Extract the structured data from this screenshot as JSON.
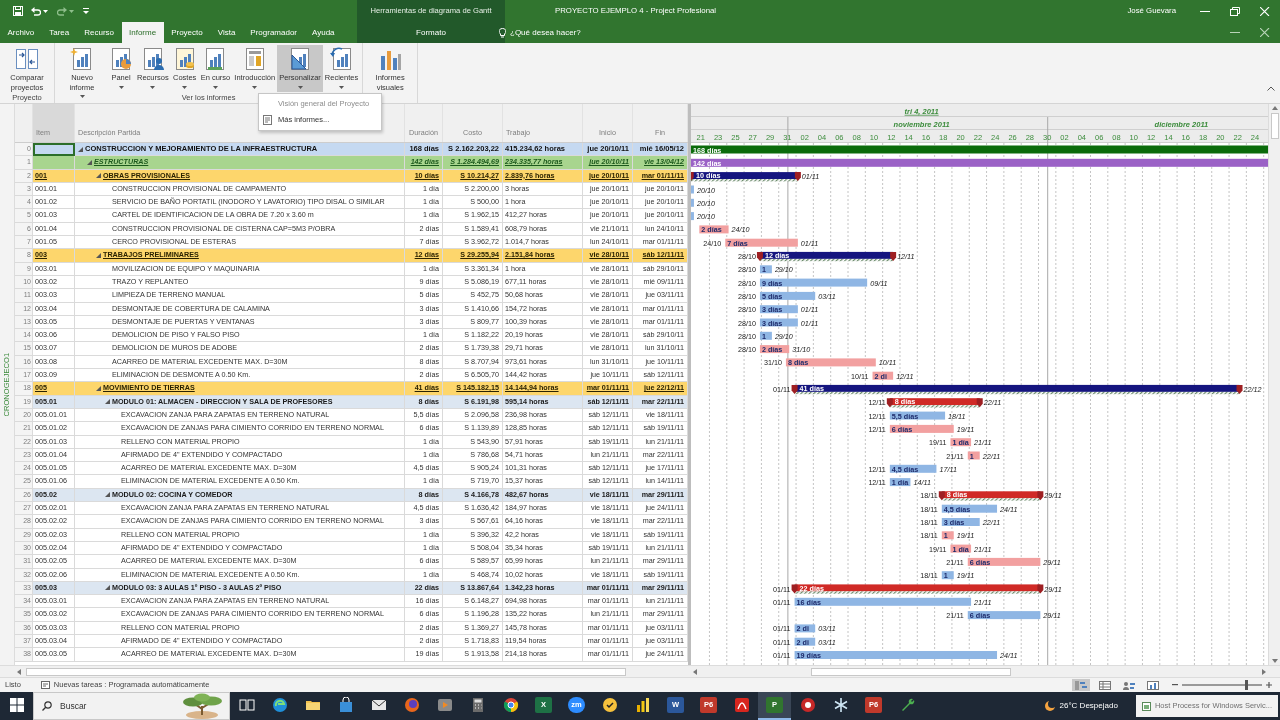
{
  "title_bar": {
    "context_group": "Herramientas de diagrama de Gantt",
    "title": "PROYECTO EJEMPLO 4  -  Project Profesional",
    "user": "José Guevara"
  },
  "tabs": [
    {
      "label": "Archivo",
      "selected": false
    },
    {
      "label": "Tarea",
      "selected": false
    },
    {
      "label": "Recurso",
      "selected": false
    },
    {
      "label": "Informe",
      "selected": true
    },
    {
      "label": "Proyecto",
      "selected": false
    },
    {
      "label": "Vista",
      "selected": false
    },
    {
      "label": "Programador",
      "selected": false
    },
    {
      "label": "Ayuda",
      "selected": false
    }
  ],
  "context_tabs": [
    {
      "label": "Formato",
      "selected": false
    }
  ],
  "tell_me": {
    "placeholder": "¿Qué desea hacer?"
  },
  "ribbon": {
    "groups": [
      {
        "label": "Proyecto",
        "buttons": [
          {
            "label": "Comparar proyectos",
            "dropdown": false,
            "pressed": false
          }
        ]
      },
      {
        "label": "Ver los informes",
        "buttons": [
          {
            "label": "Nuevo informe",
            "dropdown": true,
            "pressed": false
          },
          {
            "label": "Panel",
            "dropdown": true,
            "pressed": false
          },
          {
            "label": "Recursos",
            "dropdown": true,
            "pressed": false
          },
          {
            "label": "Costes",
            "dropdown": true,
            "pressed": false
          },
          {
            "label": "En curso",
            "dropdown": true,
            "pressed": false
          },
          {
            "label": "Introducción",
            "dropdown": true,
            "pressed": false
          },
          {
            "label": "Personalizar",
            "dropdown": true,
            "pressed": true
          },
          {
            "label": "Recientes",
            "dropdown": true,
            "pressed": false
          }
        ]
      },
      {
        "buttons": [
          {
            "label": "Informes visuales",
            "dropdown": false,
            "pressed": false
          }
        ]
      }
    ]
  },
  "menu": {
    "items": [
      {
        "label": "Visión general del Proyecto",
        "disabled": true
      },
      {
        "label": "Más informes...",
        "disabled": false
      }
    ]
  },
  "view_bar": {
    "label": "CRONOGEJECO1"
  },
  "table": {
    "columns": [
      {
        "label": "Item",
        "selected": true
      },
      {
        "label": "Descripción Partida",
        "selected": false
      },
      {
        "label": "Duración",
        "selected": false
      },
      {
        "label": "Costo",
        "selected": false
      },
      {
        "label": "Trabajo",
        "selected": false
      },
      {
        "label": "Inicio",
        "selected": false
      },
      {
        "label": "Fin",
        "selected": false
      }
    ],
    "rows": [
      {
        "id": "0",
        "description": "CONSTRUCCION Y MEJORAMIENTO DE LA INFRAESTRUCTURA",
        "duration": "168 días",
        "cost": "S 2.162.203,22",
        "work": "415.234,62 horas",
        "start": "jue 20/10/11",
        "finish": "mié 16/05/12",
        "selected": true,
        "expanded": true,
        "gantt_bar": {
          "kind": "project",
          "duration": "168 días"
        },
        "children": [
          {
            "id": "1",
            "description": "ESTRUCTURAS",
            "duration": "142 días",
            "cost": "S 1.284.494,69",
            "work": "234.335,77 horas",
            "start": "jue 20/10/11",
            "finish": "vie 13/04/12",
            "selected": false,
            "expanded": true,
            "gantt_bar": {
              "kind": "phase",
              "duration": "142 días"
            },
            "children": [
              {
                "id": "2",
                "item": "001",
                "description": "OBRAS PROVISIONALES",
                "duration": "10 días",
                "cost": "S 10.214,27",
                "work": "2.839,76 horas",
                "start": "jue 20/10/11",
                "finish": "mar 01/11/11",
                "selected": false,
                "expanded": true,
                "gantt_bar": {
                  "kind": "summary",
                  "critical": false,
                  "duration": "10 días",
                  "end": "01/11"
                },
                "children": [
                  {
                    "id": "3",
                    "item": "001.01",
                    "description": "CONSTRUCCION PROVISIONAL DE CAMPAMENTO",
                    "duration": "1 día",
                    "cost": "S 2.200,00",
                    "work": "3 horas",
                    "start": "jue 20/10/11",
                    "finish": "jue 20/10/11",
                    "selected": false,
                    "gantt_bar": {
                      "kind": "task",
                      "critical": false,
                      "end": "20/10"
                    }
                  },
                  {
                    "id": "4",
                    "item": "001.02",
                    "description": "SERVICIO DE BAÑO PORTATIL (INODORO Y LAVATORIO) TIPO DISAL O SIMILAR",
                    "duration": "1 día",
                    "cost": "S 500,00",
                    "work": "1 hora",
                    "start": "jue 20/10/11",
                    "finish": "jue 20/10/11",
                    "selected": false,
                    "gantt_bar": {
                      "kind": "task",
                      "critical": false,
                      "end": "20/10"
                    }
                  },
                  {
                    "id": "5",
                    "item": "001.03",
                    "description": "CARTEL DE IDENTIFICACION DE LA OBRA DE 7.20 x 3.60 m",
                    "duration": "1 día",
                    "cost": "S 1.962,15",
                    "work": "412,27 horas",
                    "start": "jue 20/10/11",
                    "finish": "jue 20/10/11",
                    "selected": false,
                    "gantt_bar": {
                      "kind": "task",
                      "critical": false,
                      "end": "20/10"
                    }
                  },
                  {
                    "id": "6",
                    "item": "001.04",
                    "description": "CONSTRUCCION PROVISIONAL DE CISTERNA CAP=5M3 P/OBRA",
                    "duration": "2 días",
                    "cost": "S 1.589,41",
                    "work": "608,79 horas",
                    "start": "vie 21/10/11",
                    "finish": "lun 24/10/11",
                    "selected": false,
                    "gantt_bar": {
                      "kind": "task",
                      "critical": true,
                      "duration": "2 días",
                      "end": "24/10"
                    }
                  },
                  {
                    "id": "7",
                    "item": "001.05",
                    "description": "CERCO PROVISIONAL DE ESTERAS",
                    "duration": "7 días",
                    "cost": "S 3.962,72",
                    "work": "1.014,7 horas",
                    "start": "lun 24/10/11",
                    "finish": "mar 01/11/11",
                    "selected": false,
                    "gantt_bar": {
                      "kind": "task",
                      "critical": true,
                      "start": "24/10",
                      "duration": "7 días",
                      "end": "01/11"
                    }
                  }
                ]
              },
              {
                "id": "8",
                "item": "003",
                "description": "TRABAJOS PRELIMINARES",
                "duration": "12 días",
                "cost": "S 29.255,94",
                "work": "2.151,84 horas",
                "start": "vie 28/10/11",
                "finish": "sáb 12/11/11",
                "selected": false,
                "expanded": true,
                "gantt_bar": {
                  "kind": "summary",
                  "critical": false,
                  "start": "28/10",
                  "duration": "12 días",
                  "end": "12/11"
                },
                "children": [
                  {
                    "id": "9",
                    "item": "003.01",
                    "description": "MOVILIZACION DE EQUIPO Y MAQUINARIA",
                    "duration": "1 día",
                    "cost": "S 3.361,34",
                    "work": "1 hora",
                    "start": "vie 28/10/11",
                    "finish": "sáb 29/10/11",
                    "selected": false,
                    "gantt_bar": {
                      "kind": "task",
                      "critical": false,
                      "start": "28/10",
                      "duration": "1",
                      "end": "29/10"
                    }
                  },
                  {
                    "id": "10",
                    "item": "003.02",
                    "description": "TRAZO Y REPLANTEO",
                    "duration": "9 días",
                    "cost": "S 5.086,19",
                    "work": "677,11 horas",
                    "start": "vie 28/10/11",
                    "finish": "mié 09/11/11",
                    "selected": false,
                    "gantt_bar": {
                      "kind": "task",
                      "critical": false,
                      "start": "28/10",
                      "duration": "9 días",
                      "end": "09/11"
                    }
                  },
                  {
                    "id": "11",
                    "item": "003.03",
                    "description": "LIMPIEZA DE TERRENO MANUAL",
                    "duration": "5 días",
                    "cost": "S 452,75",
                    "work": "50,68 horas",
                    "start": "vie 28/10/11",
                    "finish": "jue 03/11/11",
                    "selected": false,
                    "gantt_bar": {
                      "kind": "task",
                      "critical": false,
                      "start": "28/10",
                      "duration": "5 días",
                      "end": "03/11"
                    }
                  },
                  {
                    "id": "12",
                    "item": "003.04",
                    "description": "DESMONTAJE DE COBERTURA DE CALAMINA",
                    "duration": "3 días",
                    "cost": "S 1.410,66",
                    "work": "154,72 horas",
                    "start": "vie 28/10/11",
                    "finish": "mar 01/11/11",
                    "selected": false,
                    "gantt_bar": {
                      "kind": "task",
                      "critical": false,
                      "start": "28/10",
                      "duration": "3 días",
                      "end": "01/11"
                    }
                  },
                  {
                    "id": "13",
                    "item": "003.05",
                    "description": "DESMONTAJE DE PUERTAS Y VENTANAS",
                    "duration": "3 días",
                    "cost": "S 809,77",
                    "work": "100,39 horas",
                    "start": "vie 28/10/11",
                    "finish": "mar 01/11/11",
                    "selected": false,
                    "gantt_bar": {
                      "kind": "task",
                      "critical": false,
                      "start": "28/10",
                      "duration": "3 días",
                      "end": "01/11"
                    }
                  },
                  {
                    "id": "14",
                    "item": "003.06",
                    "description": "DEMOLICION DE PISO Y FALSO PISO",
                    "duration": "1 día",
                    "cost": "S 1.182,22",
                    "work": "20,19 horas",
                    "start": "vie 28/10/11",
                    "finish": "sáb 29/10/11",
                    "selected": false,
                    "gantt_bar": {
                      "kind": "task",
                      "critical": false,
                      "start": "28/10",
                      "duration": "1",
                      "end": "29/10"
                    }
                  },
                  {
                    "id": "15",
                    "item": "003.07",
                    "description": "DEMOLICION DE MUROS DE ADOBE",
                    "duration": "2 días",
                    "cost": "S 1.739,38",
                    "work": "29,71 horas",
                    "start": "vie 28/10/11",
                    "finish": "lun 31/10/11",
                    "selected": false,
                    "gantt_bar": {
                      "kind": "task",
                      "critical": true,
                      "start": "28/10",
                      "duration": "2 días",
                      "end": "31/10"
                    }
                  },
                  {
                    "id": "16",
                    "item": "003.08",
                    "description": "ACARREO DE MATERIAL EXCEDENTE MAX. D=30M",
                    "duration": "8 días",
                    "cost": "S 8.707,94",
                    "work": "973,61 horas",
                    "start": "lun 31/10/11",
                    "finish": "jue 10/11/11",
                    "selected": false,
                    "gantt_bar": {
                      "kind": "task",
                      "critical": true,
                      "start": "31/10",
                      "duration": "8 días",
                      "end": "10/11"
                    }
                  },
                  {
                    "id": "17",
                    "item": "003.09",
                    "description": "ELIMINACION DE DESMONTE A 0.50 Km.",
                    "duration": "2 días",
                    "cost": "S 6.505,70",
                    "work": "144,42 horas",
                    "start": "jue 10/11/11",
                    "finish": "sáb 12/11/11",
                    "selected": false,
                    "gantt_bar": {
                      "kind": "task",
                      "critical": true,
                      "start": "10/11",
                      "duration": "2 di",
                      "end": "12/11"
                    }
                  }
                ]
              },
              {
                "id": "18",
                "item": "005",
                "description": "MOVIMIENTO DE TIERRAS",
                "duration": "41 días",
                "cost": "S 145.182,15",
                "work": "14.144,94 horas",
                "start": "mar 01/11/11",
                "finish": "jue 22/12/11",
                "selected": false,
                "expanded": true,
                "gantt_bar": {
                  "kind": "summary",
                  "critical": false,
                  "start": "01/11",
                  "duration": "41 días",
                  "end": "22/12"
                },
                "children": [
                  {
                    "id": "19",
                    "item": "005.01",
                    "description": "MODULO 01: ALMACEN - DIRECCION Y SALA DE PROFESORES",
                    "duration": "8 días",
                    "cost": "S 6.191,98",
                    "work": "595,14 horas",
                    "start": "sáb 12/11/11",
                    "finish": "mar 22/11/11",
                    "selected": false,
                    "expanded": true,
                    "gantt_bar": {
                      "kind": "summary",
                      "critical": true,
                      "start": "12/11",
                      "duration": "8 días",
                      "end": "22/11"
                    },
                    "children": [
                      {
                        "id": "20",
                        "item": "005.01.01",
                        "description": "EXCAVACION ZANJA PARA ZAPATAS EN TERRENO NATURAL",
                        "duration": "5,5 días",
                        "cost": "S 2.096,58",
                        "work": "236,98 horas",
                        "start": "sáb 12/11/11",
                        "finish": "vie 18/11/11",
                        "selected": false,
                        "gantt_bar": {
                          "kind": "task",
                          "critical": false,
                          "start": "12/11",
                          "duration": "5,5 días",
                          "end": "18/11"
                        }
                      },
                      {
                        "id": "21",
                        "item": "005.01.02",
                        "description": "EXCAVACION DE ZANJAS PARA CIMIENTO CORRIDO EN TERRENO NORMAL",
                        "duration": "6 días",
                        "cost": "S 1.139,89",
                        "work": "128,85 horas",
                        "start": "sáb 12/11/11",
                        "finish": "sáb 19/11/11",
                        "selected": false,
                        "gantt_bar": {
                          "kind": "task",
                          "critical": true,
                          "start": "12/11",
                          "duration": "6 días",
                          "end": "19/11"
                        }
                      },
                      {
                        "id": "22",
                        "item": "005.01.03",
                        "description": "RELLENO CON MATERIAL PROPIO",
                        "duration": "1 día",
                        "cost": "S 543,90",
                        "work": "57,91 horas",
                        "start": "sáb 19/11/11",
                        "finish": "lun 21/11/11",
                        "selected": false,
                        "gantt_bar": {
                          "kind": "task",
                          "critical": true,
                          "start": "19/11",
                          "duration": "1 día",
                          "end": "21/11"
                        }
                      },
                      {
                        "id": "23",
                        "item": "005.01.04",
                        "description": "AFIRMADO DE 4\" EXTENDIDO Y COMPACTADO",
                        "duration": "1 día",
                        "cost": "S 786,68",
                        "work": "54,71 horas",
                        "start": "lun 21/11/11",
                        "finish": "mar 22/11/11",
                        "selected": false,
                        "gantt_bar": {
                          "kind": "task",
                          "critical": true,
                          "start": "21/11",
                          "duration": "1",
                          "end": "22/11"
                        }
                      },
                      {
                        "id": "24",
                        "item": "005.01.05",
                        "description": "ACARREO DE MATERIAL EXCEDENTE MAX. D=30M",
                        "duration": "4,5 días",
                        "cost": "S 905,24",
                        "work": "101,31 horas",
                        "start": "sáb 12/11/11",
                        "finish": "jue 17/11/11",
                        "selected": false,
                        "gantt_bar": {
                          "kind": "task",
                          "critical": false,
                          "start": "12/11",
                          "duration": "4,5 días",
                          "end": "17/11"
                        }
                      },
                      {
                        "id": "25",
                        "item": "005.01.06",
                        "description": "ELIMINACION DE MATERIAL EXCEDENTE A  0.50 Km.",
                        "duration": "1 día",
                        "cost": "S 719,70",
                        "work": "15,37 horas",
                        "start": "sáb 12/11/11",
                        "finish": "lun 14/11/11",
                        "selected": false,
                        "gantt_bar": {
                          "kind": "task",
                          "critical": false,
                          "start": "12/11",
                          "duration": "1 día",
                          "end": "14/11"
                        }
                      }
                    ]
                  },
                  {
                    "id": "26",
                    "item": "005.02",
                    "description": "MODULO 02: COCINA Y COMEDOR",
                    "duration": "8 días",
                    "cost": "S 4.166,78",
                    "work": "482,67 horas",
                    "start": "vie 18/11/11",
                    "finish": "mar 29/11/11",
                    "selected": false,
                    "expanded": true,
                    "gantt_bar": {
                      "kind": "summary",
                      "critical": true,
                      "start": "18/11",
                      "duration": "8 días",
                      "end": "29/11"
                    },
                    "children": [
                      {
                        "id": "27",
                        "item": "005.02.01",
                        "description": "EXCAVACION ZANJA PARA ZAPATAS EN TERRENO NATURAL",
                        "duration": "4,5 días",
                        "cost": "S 1.636,42",
                        "work": "184,97 horas",
                        "start": "vie 18/11/11",
                        "finish": "jue 24/11/11",
                        "selected": false,
                        "gantt_bar": {
                          "kind": "task",
                          "critical": false,
                          "start": "18/11",
                          "duration": "4,5 días",
                          "end": "24/11"
                        }
                      },
                      {
                        "id": "28",
                        "item": "005.02.02",
                        "description": "EXCAVACION DE ZANJAS PARA CIMIENTO CORRIDO EN TERRENO NORMAL",
                        "duration": "3 días",
                        "cost": "S 567,61",
                        "work": "64,16 horas",
                        "start": "vie 18/11/11",
                        "finish": "mar 22/11/11",
                        "selected": false,
                        "gantt_bar": {
                          "kind": "task",
                          "critical": false,
                          "start": "18/11",
                          "duration": "3 días",
                          "end": "22/11"
                        }
                      },
                      {
                        "id": "29",
                        "item": "005.02.03",
                        "description": "RELLENO CON MATERIAL PROPIO",
                        "duration": "1 día",
                        "cost": "S 396,32",
                        "work": "42,2 horas",
                        "start": "vie 18/11/11",
                        "finish": "sáb 19/11/11",
                        "selected": false,
                        "gantt_bar": {
                          "kind": "task",
                          "critical": true,
                          "start": "18/11",
                          "duration": "1",
                          "end": "19/11"
                        }
                      },
                      {
                        "id": "30",
                        "item": "005.02.04",
                        "description": "AFIRMADO DE 4\" EXTENDIDO Y COMPACTADO",
                        "duration": "1 día",
                        "cost": "S 508,04",
                        "work": "35,34 horas",
                        "start": "sáb 19/11/11",
                        "finish": "lun 21/11/11",
                        "selected": false,
                        "gantt_bar": {
                          "kind": "task",
                          "critical": true,
                          "start": "19/11",
                          "duration": "1 día",
                          "end": "21/11"
                        }
                      },
                      {
                        "id": "31",
                        "item": "005.02.05",
                        "description": "ACARREO DE MATERIAL EXCEDENTE MAX. D=30M",
                        "duration": "6 días",
                        "cost": "S 589,57",
                        "work": "65,99 horas",
                        "start": "lun 21/11/11",
                        "finish": "mar 29/11/11",
                        "selected": false,
                        "gantt_bar": {
                          "kind": "task",
                          "critical": true,
                          "start": "21/11",
                          "duration": "6 días",
                          "end": "29/11"
                        }
                      },
                      {
                        "id": "32",
                        "item": "005.02.06",
                        "description": "ELIMINACION DE MATERIAL EXCEDENTE A  0.50 Km.",
                        "duration": "1 día",
                        "cost": "S 468,74",
                        "work": "10,02 horas",
                        "start": "vie 18/11/11",
                        "finish": "sáb 19/11/11",
                        "selected": false,
                        "gantt_bar": {
                          "kind": "task",
                          "critical": false,
                          "start": "18/11",
                          "duration": "1",
                          "end": "19/11"
                        }
                      }
                    ]
                  },
                  {
                    "id": "33",
                    "item": "005.03",
                    "description": "MODULO 03: 3 AULAS 1º PISO - 3 AULAS 2º PISO",
                    "duration": "22 días",
                    "cost": "S 13.867,64",
                    "work": "1.342,23 horas",
                    "start": "mar 01/11/11",
                    "finish": "mar 29/11/11",
                    "selected": false,
                    "expanded": true,
                    "gantt_bar": {
                      "kind": "summary",
                      "critical": true,
                      "start": "01/11",
                      "duration": "22 días",
                      "end": "29/11"
                    },
                    "children": [
                      {
                        "id": "34",
                        "item": "005.03.01",
                        "description": "EXCAVACION ZANJA PARA ZAPATAS EN TERRENO NATURAL",
                        "duration": "16 días",
                        "cost": "S 6.148,27",
                        "work": "694,98 horas",
                        "start": "mar 01/11/11",
                        "finish": "lun 21/11/11",
                        "selected": false,
                        "gantt_bar": {
                          "kind": "task",
                          "critical": false,
                          "start": "01/11",
                          "duration": "16 días",
                          "end": "21/11"
                        }
                      },
                      {
                        "id": "35",
                        "item": "005.03.02",
                        "description": "EXCAVACION DE ZANJAS PARA CIMIENTO CORRIDO EN TERRENO NORMAL",
                        "duration": "6 días",
                        "cost": "S 1.196,28",
                        "work": "135,22 horas",
                        "start": "lun 21/11/11",
                        "finish": "mar 29/11/11",
                        "selected": false,
                        "gantt_bar": {
                          "kind": "task",
                          "critical": false,
                          "start": "21/11",
                          "duration": "6 días",
                          "end": "29/11"
                        }
                      },
                      {
                        "id": "36",
                        "item": "005.03.03",
                        "description": "RELLENO CON MATERIAL PROPIO",
                        "duration": "2 días",
                        "cost": "S 1.369,27",
                        "work": "145,78 horas",
                        "start": "mar 01/11/11",
                        "finish": "jue 03/11/11",
                        "selected": false,
                        "gantt_bar": {
                          "kind": "task",
                          "critical": false,
                          "start": "01/11",
                          "duration": "2 di",
                          "end": "03/11"
                        }
                      },
                      {
                        "id": "37",
                        "item": "005.03.04",
                        "description": "AFIRMADO DE 4\" EXTENDIDO Y COMPACTADO",
                        "duration": "2 días",
                        "cost": "S 1.718,83",
                        "work": "119,54 horas",
                        "start": "mar 01/11/11",
                        "finish": "jue 03/11/11",
                        "selected": false,
                        "gantt_bar": {
                          "kind": "task",
                          "critical": false,
                          "start": "01/11",
                          "duration": "2 di",
                          "end": "03/11"
                        }
                      },
                      {
                        "id": "38",
                        "item": "005.03.05",
                        "description": "ACARREO DE MATERIAL EXCEDENTE MAX. D=30M",
                        "duration": "19 días",
                        "cost": "S 1.913,58",
                        "work": "214,18 horas",
                        "start": "mar 01/11/11",
                        "finish": "jue 24/11/11",
                        "selected": false,
                        "gantt_bar": {
                          "kind": "task",
                          "critical": false,
                          "start": "01/11",
                          "duration": "19 días",
                          "end": "24/11"
                        }
                      }
                    ]
                  }
                ]
              }
            ]
          }
        ]
      }
    ]
  },
  "gantt": {
    "quarter": "tri 4, 2011",
    "months": [
      {
        "days": [
          "21",
          "23",
          "25",
          "27",
          "29",
          "31"
        ]
      },
      {
        "label": "noviembre 2011",
        "days": [
          "02",
          "04",
          "06",
          "08",
          "10",
          "12",
          "14",
          "16",
          "18",
          "20",
          "22",
          "24",
          "26",
          "28",
          "30"
        ]
      },
      {
        "label": "diciembre 2011",
        "days": [
          "02",
          "04",
          "06",
          "08",
          "10",
          "12",
          "14",
          "16",
          "18",
          "20",
          "22",
          "24"
        ]
      }
    ]
  },
  "status_bar": {
    "ready": "Listo",
    "new_tasks": "Nuevas tareas : Programada automáticamente",
    "views": [
      {
        "selected": true
      },
      {
        "selected": false
      },
      {
        "selected": false
      },
      {
        "selected": false
      }
    ],
    "zoom": {
      "level": 0.8
    }
  },
  "taskbar": {
    "search": {
      "placeholder": "Buscar"
    },
    "apps": [
      {
        "kind": "taskview",
        "active": false
      },
      {
        "kind": "swirl",
        "active": false
      },
      {
        "kind": "folder",
        "active": false
      },
      {
        "kind": "bag",
        "active": false
      },
      {
        "kind": "mail",
        "active": false
      },
      {
        "kind": "fox",
        "active": false
      },
      {
        "kind": "media",
        "active": false
      },
      {
        "kind": "calculator",
        "active": false
      },
      {
        "kind": "ring",
        "active": false
      },
      {
        "kind": "sheet",
        "label": "X",
        "active": false
      },
      {
        "kind": "video",
        "label": "zm",
        "active": false
      },
      {
        "kind": "shield",
        "active": false
      },
      {
        "kind": "columns",
        "active": false
      },
      {
        "kind": "doc",
        "label": "W",
        "active": false
      },
      {
        "kind": "p6",
        "label": "P6",
        "active": false
      },
      {
        "kind": "pdf",
        "active": false
      },
      {
        "kind": "plan",
        "label": "P",
        "active": true
      },
      {
        "kind": "record",
        "active": false
      },
      {
        "kind": "snowflake",
        "active": false
      },
      {
        "kind": "p6",
        "label": "P6",
        "active": false
      },
      {
        "kind": "tool",
        "active": false
      }
    ],
    "weather": "26°C Despejado",
    "notification": "Host Process for Windows Servic..."
  }
}
